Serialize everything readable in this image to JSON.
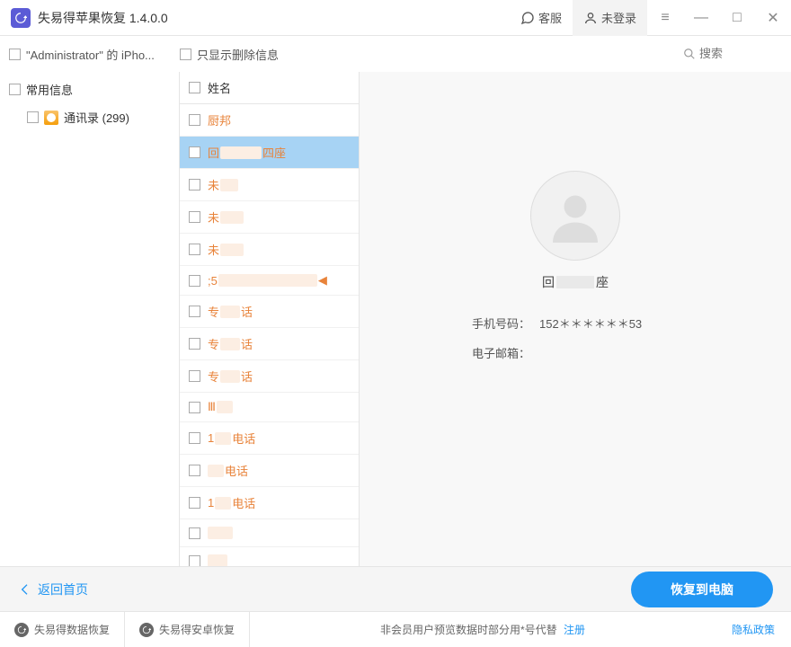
{
  "titlebar": {
    "app_title": "失易得苹果恢复  1.4.0.0",
    "support": "客服",
    "login": "未登录"
  },
  "toolbar": {
    "device_label": "\"Administrator\" 的 iPho...",
    "deleted_only": "只显示删除信息",
    "search_placeholder": "搜索"
  },
  "sidebar": {
    "root": "常用信息",
    "contacts_label": "通讯录  (299)"
  },
  "list": {
    "header": "姓名",
    "rows": [
      {
        "pre": "厨邦",
        "mask_w": 0,
        "post": ""
      },
      {
        "pre": "回",
        "mask_w": 46,
        "post": "四座",
        "selected": true
      },
      {
        "pre": "未",
        "mask_w": 20,
        "post": ""
      },
      {
        "pre": "未",
        "mask_w": 26,
        "post": ""
      },
      {
        "pre": "未",
        "mask_w": 26,
        "post": ""
      },
      {
        "pre": ";5",
        "mask_w": 110,
        "post": "",
        "extra_icon": true
      },
      {
        "pre": "专",
        "mask_w": 22,
        "post": "话"
      },
      {
        "pre": "专",
        "mask_w": 22,
        "post": "话"
      },
      {
        "pre": "专",
        "mask_w": 22,
        "post": "话"
      },
      {
        "pre": "Ⅲ",
        "mask_w": 18,
        "post": ""
      },
      {
        "pre": "1",
        "mask_w": 18,
        "post": "电话"
      },
      {
        "pre": "",
        "mask_w": 18,
        "post": "电话"
      },
      {
        "pre": "1",
        "mask_w": 18,
        "post": "电话"
      },
      {
        "pre": "",
        "mask_w": 28,
        "post": ""
      },
      {
        "pre": "",
        "mask_w": 22,
        "post": ""
      },
      {
        "pre": "",
        "mask_w": 22,
        "post": ""
      }
    ]
  },
  "detail": {
    "name_pre": "回",
    "name_post": "座",
    "phone_label": "手机号码：",
    "phone_value": "152＊＊＊＊＊＊53",
    "email_label": "电子邮箱："
  },
  "bottom": {
    "back": "返回首页",
    "recover": "恢复到电脑"
  },
  "footer": {
    "link1": "失易得数据恢复",
    "link2": "失易得安卓恢复",
    "note": "非会员用户预览数据时部分用*号代替",
    "register": "注册",
    "privacy": "隐私政策"
  }
}
